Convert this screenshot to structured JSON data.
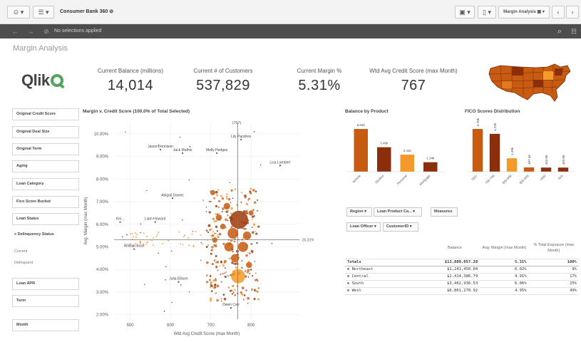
{
  "toolbar": {
    "app_title": "Consumer Bank 360",
    "sheet_name": "Margin Analysis"
  },
  "selections": {
    "text": "No selections applied"
  },
  "sheet": {
    "title": "Margin Analysis"
  },
  "logo": {
    "text": "Qlik"
  },
  "kpis": [
    {
      "label": "Current Balance (millions)",
      "value": "14,014"
    },
    {
      "label": "Current # of Customers",
      "value": "537,829"
    },
    {
      "label": "Current Margin %",
      "value": "5.31%"
    },
    {
      "label": "Wtd Avg Credit Score (max Month)",
      "value": "767"
    }
  ],
  "filters": [
    "Original Credit Score",
    "Original Deal Size",
    "Original Term",
    "Aging",
    "Loan Category",
    "Fico Score Bucket",
    "Loan Status"
  ],
  "delinquency": {
    "title": "Delinquency Status",
    "items": [
      "Current",
      "Delinquent"
    ]
  },
  "filters2": [
    "Loan APR",
    "Term",
    "Month"
  ],
  "scatter": {
    "title": "Margin v. Credit Score (100.0% of Total Selected)",
    "xlabel": "Wtd Avg Credit Score (max Month)",
    "ylabel": "Avg. Margin (max Month)",
    "ref_x_label": "(767)",
    "ref_y_label": "(5.31%)",
    "names": [
      "Jason Dennison",
      "Jack Mathis",
      "Molly Hodges",
      "Lily Pandora",
      "Lisa Lambert",
      "Abigail Davies",
      "Liam Howard",
      "Kei...",
      "William Bose",
      "Julia Ellison",
      "Owen Carr"
    ]
  },
  "chart_data": [
    {
      "type": "scatter",
      "title": "Margin v. Credit Score (100.0% of Total Selected)",
      "xlabel": "Wtd Avg Credit Score (max Month)",
      "ylabel": "Avg. Margin (max Month)",
      "xlim": [
        460,
        920
      ],
      "ylim": [
        1.8,
        10.5
      ],
      "x_ticks": [
        "500",
        "600",
        "700",
        "800"
      ],
      "y_ticks": [
        "2.00%",
        "3.00%",
        "4.00%",
        "5.00%",
        "6.00%",
        "7.00%",
        "8.00%",
        "9.00%",
        "10.00%"
      ],
      "reference_lines": {
        "x": 767,
        "y": 5.31
      },
      "labeled_points": [
        {
          "name": "Jason Dennison",
          "x": 575,
          "y": 9.3
        },
        {
          "name": "Jack Mathis",
          "x": 630,
          "y": 9.15
        },
        {
          "name": "Molly Hodges",
          "x": 715,
          "y": 9.15
        },
        {
          "name": "Lily Pandora",
          "x": 775,
          "y": 9.75
        },
        {
          "name": "Lisa Lambert",
          "x": 872,
          "y": 8.6
        },
        {
          "name": "Abigail Davies",
          "x": 605,
          "y": 7.15
        },
        {
          "name": "Liam Howard",
          "x": 562,
          "y": 6.1
        },
        {
          "name": "Kei...",
          "x": 475,
          "y": 6.1
        },
        {
          "name": "William Bose",
          "x": 510,
          "y": 4.9
        },
        {
          "name": "Julia Ellison",
          "x": 620,
          "y": 3.45
        },
        {
          "name": "Owen Carr",
          "x": 750,
          "y": 2.3
        }
      ],
      "bubbles": [
        {
          "x": 770,
          "y": 6.2,
          "size": 3
        },
        {
          "x": 768,
          "y": 3.7,
          "size": 2.2
        },
        {
          "x": 755,
          "y": 5.6,
          "size": 1.5
        },
        {
          "x": 780,
          "y": 5.0,
          "size": 1.4
        },
        {
          "x": 745,
          "y": 5.0,
          "size": 1.2
        },
        {
          "x": 790,
          "y": 5.5,
          "size": 1.0
        },
        {
          "x": 760,
          "y": 4.5,
          "size": 1.0
        },
        {
          "x": 740,
          "y": 6.8,
          "size": 0.7
        },
        {
          "x": 720,
          "y": 6.3,
          "size": 0.6
        },
        {
          "x": 795,
          "y": 4.2,
          "size": 0.6
        },
        {
          "x": 730,
          "y": 5.9,
          "size": 0.5
        },
        {
          "x": 705,
          "y": 7.4,
          "size": 0.4
        },
        {
          "x": 800,
          "y": 6.5,
          "size": 0.4
        },
        {
          "x": 710,
          "y": 5.3,
          "size": 0.4
        }
      ]
    },
    {
      "type": "bar",
      "title": "Balance by Product",
      "categories": [
        "Vehicle",
        "Student",
        "Personal",
        "Mortgage"
      ],
      "values": [
        6.04,
        3.46,
        2.41,
        1.34
      ],
      "value_labels": [
        "6.04k",
        "3.46k",
        "2.41k",
        "1.34k"
      ]
    },
    {
      "type": "bar",
      "title": "FICO Scores Distribution",
      "categories": [
        "750+",
        "700-749",
        "650-699",
        "600-649",
        "<600",
        "N/A"
      ],
      "values": [
        4.75,
        4.21,
        1.49,
        0.48,
        0.46,
        0.46
      ],
      "value_labels": [
        "4.75k",
        "4.21k",
        "1.49k",
        "487.46",
        "463.06",
        "463.06"
      ]
    }
  ],
  "product_chart": {
    "title": "Balance by Product"
  },
  "fico_chart": {
    "title": "FICO Scores Distribution"
  },
  "table_filters": {
    "region": "Region",
    "loan_product": "Loan Product Ca...",
    "measures": "Measures",
    "loan_officer": "Loan Officer",
    "customer": "CustomerID"
  },
  "table": {
    "headers": [
      "",
      "Balance",
      "Avg. Margin (max Month)",
      "% Total Exposure (max Month)"
    ],
    "totals": {
      "label": "Totals",
      "balance": "$13,889,057.28",
      "margin": "5.31%",
      "exposure": "100%"
    },
    "rows": [
      {
        "region": "Northeast",
        "balance": "$1,241,450.04",
        "margin": "6.02%",
        "exposure": "9%"
      },
      {
        "region": "Central",
        "balance": "$2,414,386.79",
        "margin": "4.91%",
        "exposure": "17%"
      },
      {
        "region": "South",
        "balance": "$3,462,936.53",
        "margin": "6.06%",
        "exposure": "25%"
      },
      {
        "region": "West",
        "balance": "$6,861,278.92",
        "margin": "4.95%",
        "exposure": "49%"
      }
    ]
  },
  "colors": {
    "dark": "#8b2e0b",
    "mid": "#c75b11",
    "light": "#f39a2a",
    "pale": "#f7b25c",
    "accent": "#52a35b"
  },
  "icons": [
    "selections-tool-icon",
    "list-menu-icon",
    "back-icon",
    "forward-icon",
    "clear-icon",
    "search-icon",
    "smart-search-icon",
    "bookmark-icon",
    "sheet-icon",
    "prev-sheet-icon",
    "next-sheet-icon",
    "usa-map-thumbnail"
  ]
}
